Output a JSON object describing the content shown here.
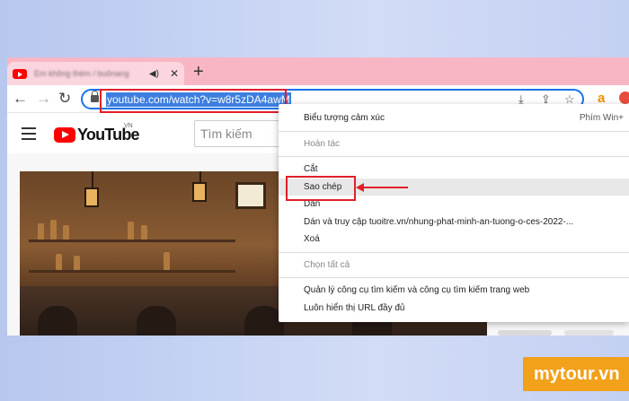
{
  "browser": {
    "tab_title": "Em không thèm / buônang",
    "url": "youtube.com/watch?v=w8r5zDA4awM",
    "ext_label": "a"
  },
  "youtube": {
    "logo_text": "YouTube",
    "region": "VN",
    "search_placeholder": "Tìm kiếm"
  },
  "context_menu": {
    "items": [
      {
        "label": "Biểu tượng cảm xúc",
        "shortcut": "Phím Win+"
      },
      {
        "label": "Hoàn tác",
        "disabled": true
      },
      {
        "label": "Cắt"
      },
      {
        "label": "Sao chép",
        "highlighted": true
      },
      {
        "label": "Dán"
      },
      {
        "label": "Dán và truy cập tuoitre.vn/nhung-phat-minh-an-tuong-o-ces-2022-..."
      },
      {
        "label": "Xoá"
      },
      {
        "label": "Chọn tất cả",
        "disabled": true
      },
      {
        "label": "Quản lý công cụ tìm kiếm và công cụ tìm kiếm trang web"
      },
      {
        "label": "Luôn hiển thị URL đầy đủ"
      }
    ]
  },
  "watermark": {
    "text": "mytour.vn"
  },
  "colors": {
    "annotation": "#e0202a",
    "brand": "#f2a11a",
    "selection": "#3d7fe0"
  }
}
